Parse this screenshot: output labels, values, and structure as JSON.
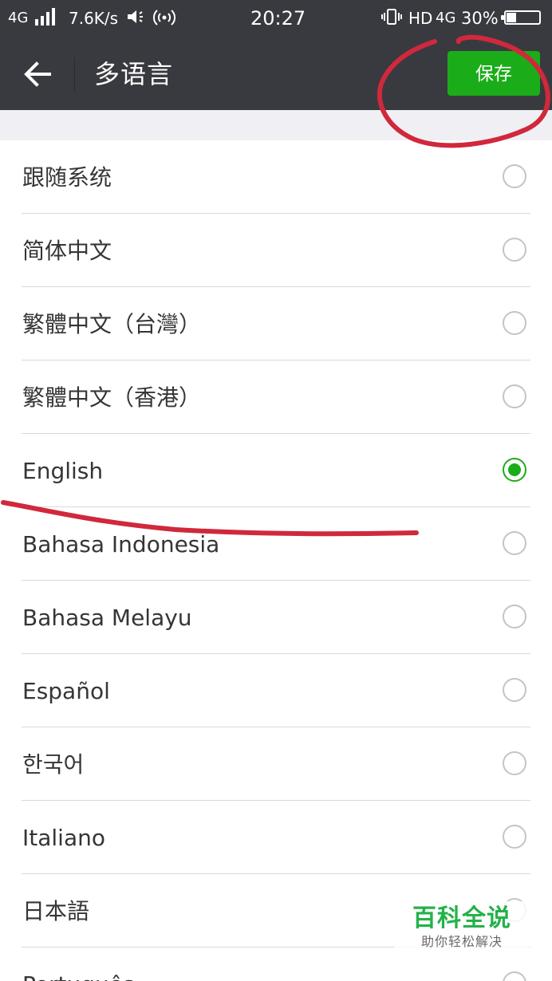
{
  "status_bar": {
    "network": "4G",
    "speed": "7.6K/s",
    "time": "20:27",
    "hd": "HD",
    "network2": "4G",
    "battery_percent": "30%",
    "battery_level": 0.3,
    "icons": [
      "signal-bars-icon",
      "volume-icon",
      "hotspot-icon",
      "vibrate-icon",
      "battery-icon"
    ]
  },
  "header": {
    "title": "多语言",
    "back_icon": "arrow-left-icon",
    "save_label": "保存"
  },
  "languages": [
    {
      "label": "跟随系统",
      "selected": false
    },
    {
      "label": "简体中文",
      "selected": false
    },
    {
      "label": "繁體中文（台灣）",
      "selected": false
    },
    {
      "label": "繁體中文（香港）",
      "selected": false
    },
    {
      "label": "English",
      "selected": true
    },
    {
      "label": "Bahasa Indonesia",
      "selected": false
    },
    {
      "label": "Bahasa Melayu",
      "selected": false
    },
    {
      "label": "Español",
      "selected": false
    },
    {
      "label": "한국어",
      "selected": false
    },
    {
      "label": "Italiano",
      "selected": false
    },
    {
      "label": "日本語",
      "selected": false
    },
    {
      "label": "Português",
      "selected": false
    }
  ],
  "watermark": {
    "title": "百科全说",
    "subtitle": "助你轻松解决"
  },
  "colors": {
    "header_bg": "#393a3f",
    "accent_green": "#1aad19",
    "annotation_red": "#d0283c",
    "list_bg": "#ffffff",
    "spacer_bg": "#efeff4"
  }
}
